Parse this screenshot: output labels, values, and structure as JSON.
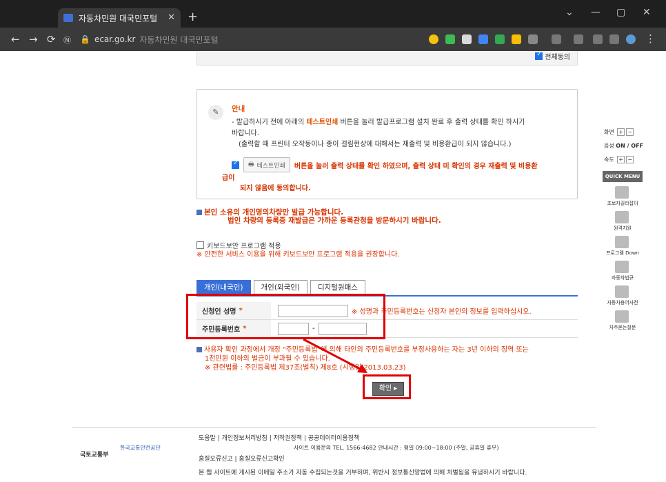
{
  "browser": {
    "tab_title": "자동차민원 대국민포털",
    "domain": "ecar.go.kr",
    "page_title": "자동차민원 대국민포털"
  },
  "agree_all": "전체동의",
  "notice": {
    "title": "안내",
    "line1_pre": "- 발급하시기 전에 아래의",
    "line1_hl": "테스트인쇄",
    "line1_post": "버튼을 눌러 발급프로그램 설치 완료 후 출력 상태를 확인 하시기",
    "line2": "바랍니다.",
    "line3": "(출력할 때 프린터 오작동이나 종이 걸림현상에 대해서는 재출력 및 비용환급이 되지 않습니다.)",
    "test_button": "테스트인쇄",
    "confirm_text": "버튼을 눌러 출력 상태를 확인 하였으며, 출력 상태 미 확인의 경우 재출력 및 비용환",
    "confirm_text2": "급이",
    "confirm_text3": "되지 않음에 동의합니다."
  },
  "owner_notice": {
    "line1": "본인 소유의 개인명의차량만 발급 가능합니다.",
    "line2": "법인 차량의 등록증 재발급은 가까운 등록관청을 방문하시기 바랍니다."
  },
  "keyboard": {
    "label": "키보드보안 프로그램 적용",
    "hint": "※ 안전한 서비스 이용을 위해 키보드보안 프로그램 적용을 권장합니다."
  },
  "tabs": [
    "개인(내국인)",
    "개인(외국인)",
    "디지털원패스"
  ],
  "form": {
    "name_label": "신청인 성명",
    "rrn_label": "주민등록번호",
    "required": "*",
    "hint": "※ 성명과 주민등록번호는 신청자 본인의 정보를 입력하십시오.",
    "dash": "-"
  },
  "warning": {
    "line1": "사용자 확인 과정에서 개정 \"주민등록법\"에 의해 타인의 주민등록번호를 부정사용하는 자는 3년 이하의 징역 또는",
    "line2": "1천만원 이하의 벌금이 부과될 수 있습니다.",
    "line3": "※ 관련법률 : 주민등록법 제37조(벌칙) 제8호 (시행일 2013.03.23)"
  },
  "confirm_button": "확인",
  "footer": {
    "org1": "국토교통부",
    "org2": "한국교통안전공단",
    "links": "도움말 | 개인정보처리방침 | 저작권정책 | 공공데이터이용정책",
    "contact": "사이트 이용문의  TEL. 1566-4682   안내시간 : 평일 09:00~18:00 (주말, 공휴일 휴무)",
    "report": "홈질오류신고 | 홈질오류신고확인",
    "policy": "본 웹 사이트에 게시된 이메일 주소가 자동 수집되는것을 거부하며, 위반시 정보통신망법에 의해 처벌됨을 유념하시기 바랍니다."
  },
  "side": {
    "zoom": "화면",
    "voice": "음성",
    "voice_state": "ON / OFF",
    "speed": "속도",
    "quick": "QUICK MENU",
    "items": [
      "초보자길라잡이",
      "원격지원",
      "프로그램 Down",
      "자동차법규",
      "자동차용어사전",
      "자주묻는질문"
    ]
  }
}
